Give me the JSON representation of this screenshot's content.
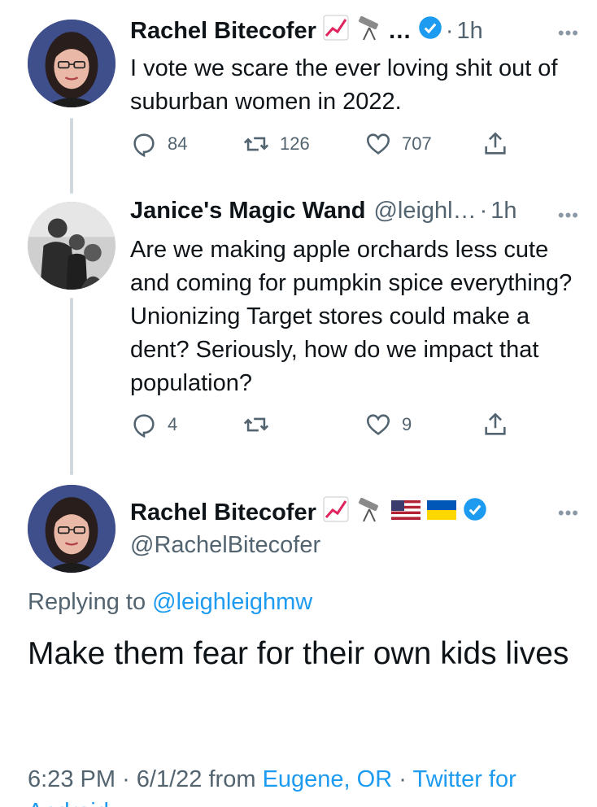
{
  "tweets": [
    {
      "name": "Rachel Bitecofer",
      "emoji_suffix": "…",
      "dot": "·",
      "time": "1h",
      "text": "I vote we scare the ever loving shit out of suburban women in 2022.",
      "replies": "84",
      "retweets": "126",
      "likes": "707",
      "more": "•••"
    },
    {
      "name": "Janice's Magic Wand",
      "handle": "@leighl…",
      "dot": "·",
      "time": "1h",
      "text": "Are we making apple orchards less cute and coming for pumpkin spice everything? Unionizing Target stores could make a dent? Seriously, how do we impact that population?",
      "replies": "4",
      "retweets": "",
      "likes": "9",
      "more": "•••"
    }
  ],
  "main_tweet": {
    "name": "Rachel Bitecofer",
    "handle": "@RachelBitecofer",
    "more": "•••",
    "replying_prefix": "Replying to",
    "replying_to": "@leighleighmw",
    "text": "Make them fear for their own kids lives",
    "time": "6:23 PM",
    "dot1": "·",
    "date": "6/1/22",
    "from": "from",
    "location": "Eugene, OR",
    "dot2": "·",
    "client": "Twitter for",
    "client_cont": "Android"
  },
  "icons": [
    "reply-icon",
    "retweet-icon",
    "like-icon",
    "share-icon",
    "verified-badge-icon",
    "chart-emoji-icon",
    "telescope-emoji-icon",
    "us-flag-emoji-icon",
    "ukraine-flag-emoji-icon"
  ],
  "colors": {
    "accent": "#1d9bf0",
    "secondary_text": "#536471",
    "thread_line": "#cfd9de"
  }
}
